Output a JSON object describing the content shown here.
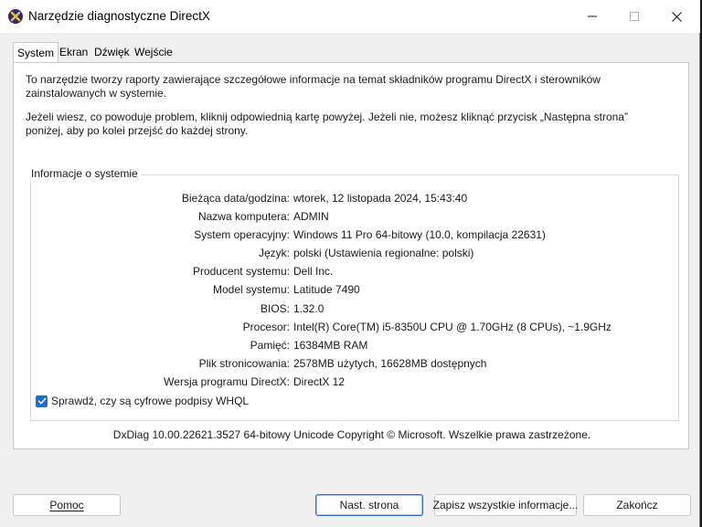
{
  "window": {
    "title": "Narzędzie diagnostyczne DirectX",
    "icon": "directx-icon"
  },
  "tabs": [
    {
      "label": "System",
      "active": true
    },
    {
      "label": "Ekran",
      "active": false
    },
    {
      "label": "Dźwięk",
      "active": false
    },
    {
      "label": "Wejście",
      "active": false
    }
  ],
  "intro": {
    "p1": "To narzędzie tworzy raporty zawierające szczegółowe informacje na temat składników programu DirectX i sterowników zainstalowanych w systemie.",
    "p2": "Jeżeli wiesz, co powoduje problem, kliknij odpowiednią kartę powyżej. Jeżeli nie, możesz kliknąć przycisk „Następna strona” poniżej, aby po kolei przejść do każdej strony."
  },
  "system_info": {
    "group_title": "Informacje o systemie",
    "rows": [
      {
        "label": "Bieżąca data/godzina:",
        "value": "wtorek, 12 listopada 2024, 15:43:40"
      },
      {
        "label": "Nazwa komputera:",
        "value": "ADMIN"
      },
      {
        "label": "System operacyjny:",
        "value": "Windows 11 Pro 64-bitowy (10.0, kompilacja 22631)"
      },
      {
        "label": "Język:",
        "value": "polski (Ustawienia regionalne: polski)"
      },
      {
        "label": "Producent systemu:",
        "value": "Dell Inc."
      },
      {
        "label": "Model systemu:",
        "value": "Latitude 7490"
      },
      {
        "label": "BIOS:",
        "value": "1.32.0"
      },
      {
        "label": "Procesor:",
        "value": "Intel(R) Core(TM) i5-8350U CPU @ 1.70GHz (8 CPUs), ~1.9GHz"
      },
      {
        "label": "Pamięć:",
        "value": "16384MB RAM"
      },
      {
        "label": "Plik stronicowania:",
        "value": "2578MB użytych, 16628MB dostępnych"
      },
      {
        "label": "Wersja programu DirectX:",
        "value": "DirectX 12"
      }
    ],
    "checkbox_label": "Sprawdź, czy są cyfrowe podpisy WHQL",
    "checkbox_checked": true
  },
  "footer": "DxDiag 10.00.22621.3527 64-bitowy Unicode  Copyright © Microsoft. Wszelkie prawa zastrzeżone.",
  "buttons": {
    "help": "Pomoc",
    "next": "Nast. strona",
    "save_all": "Zapisz wszystkie informacje...",
    "exit": "Zakończ"
  },
  "colors": {
    "accent": "#1a6fd1",
    "window_bg": "#f0f0f0",
    "panel_bg": "#ffffff"
  }
}
